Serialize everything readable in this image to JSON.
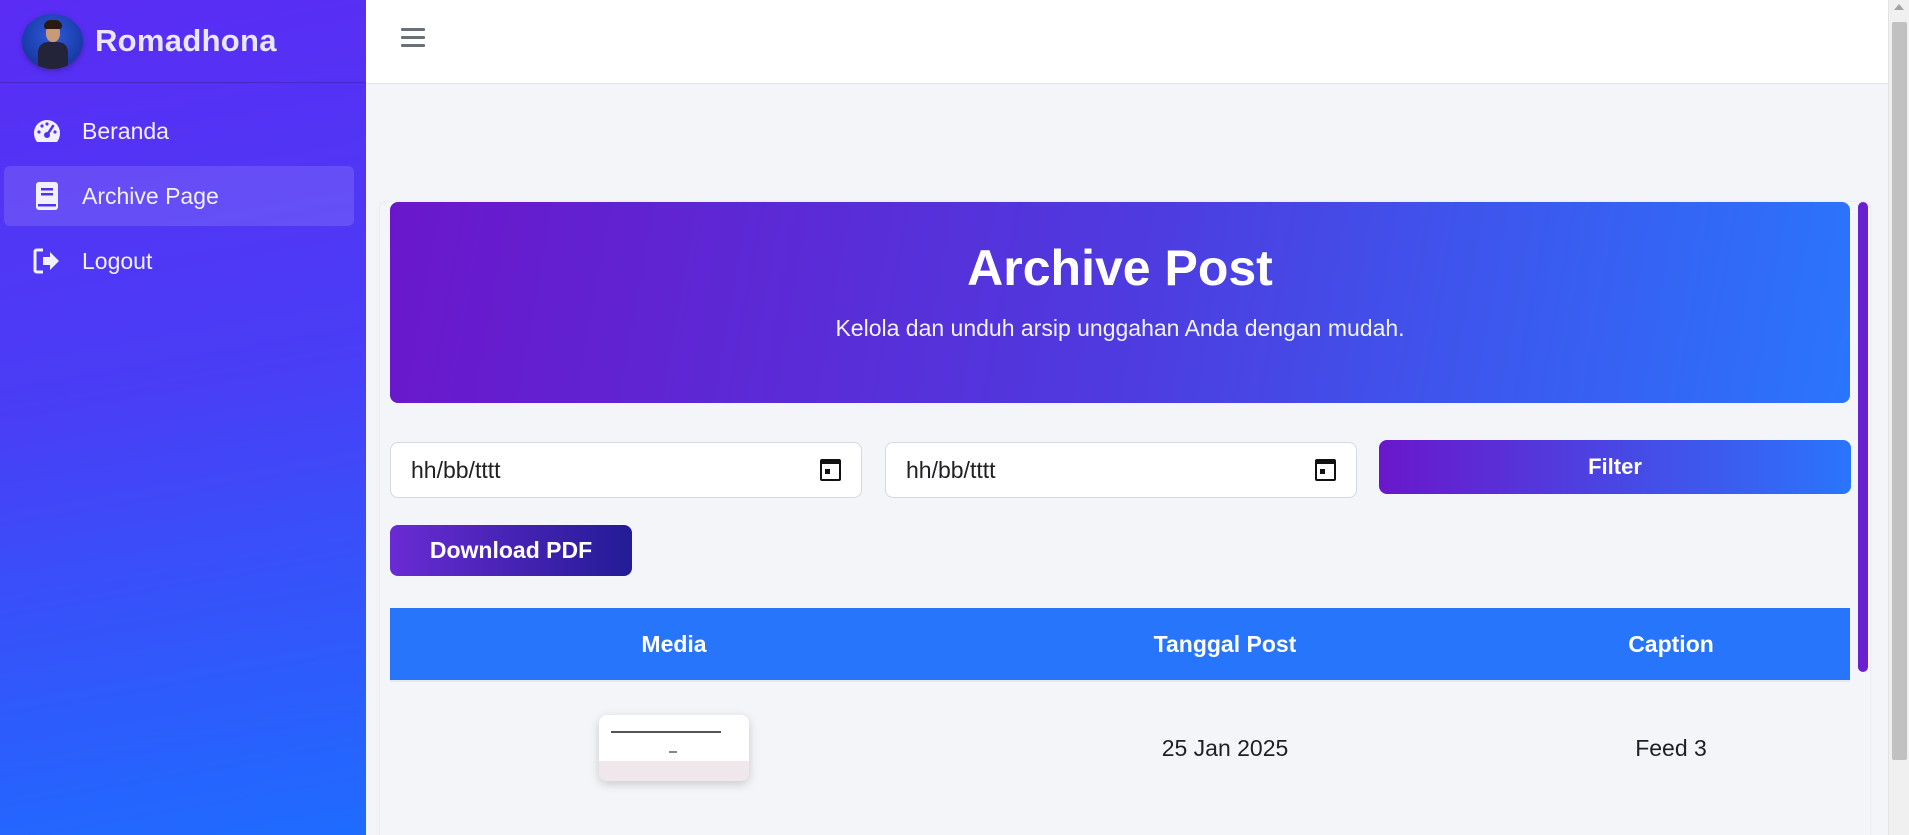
{
  "sidebar": {
    "brand_name": "Romadhona",
    "items": [
      {
        "label": "Beranda",
        "icon": "dashboard-icon"
      },
      {
        "label": "Archive Page",
        "icon": "book-icon",
        "active": true
      },
      {
        "label": "Logout",
        "icon": "logout-icon"
      }
    ]
  },
  "topbar": {
    "menu_icon": "hamburger-icon"
  },
  "hero": {
    "title": "Archive Post",
    "subtitle": "Kelola dan unduh arsip unggahan Anda dengan mudah."
  },
  "filters": {
    "start_date_placeholder": "hh/bb/tttt",
    "end_date_placeholder": "hh/bb/tttt",
    "filter_label": "Filter"
  },
  "download_label": "Download PDF",
  "table": {
    "headers": [
      "Media",
      "Tanggal Post",
      "Caption"
    ],
    "rows": [
      {
        "date": "25 Jan 2025",
        "caption": "Feed 3"
      }
    ]
  },
  "colors": {
    "accent_blue": "#2775fb",
    "accent_purple": "#6a17cb",
    "sidebar_top": "#5a2cf4",
    "sidebar_bottom": "#1e6cff"
  }
}
